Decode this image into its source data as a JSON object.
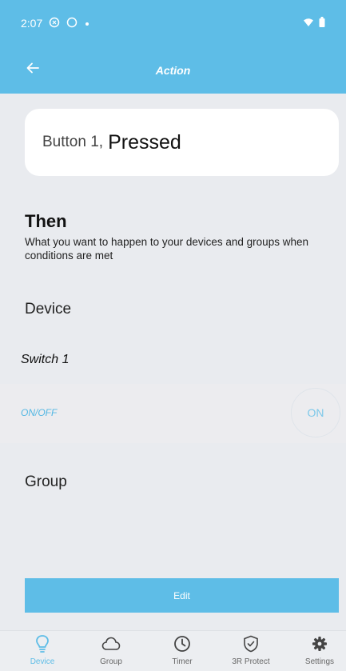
{
  "status_bar": {
    "time": "2:07"
  },
  "app_bar": {
    "title": "Action"
  },
  "trigger": {
    "source": "Button 1,",
    "state": "Pressed"
  },
  "then": {
    "title": "Then",
    "description": "What you want to happen to your devices and groups when conditions are met"
  },
  "device_section": {
    "label": "Device",
    "switch_name": "Switch 1",
    "control_label": "ON/OFF",
    "control_value": "ON"
  },
  "group_section": {
    "label": "Group"
  },
  "edit_button": {
    "label": "Edit"
  },
  "bottom_nav": {
    "active": "Device",
    "items": [
      {
        "label": "Device",
        "icon": "lightbulb-icon"
      },
      {
        "label": "Group",
        "icon": "cloud-icon"
      },
      {
        "label": "Timer",
        "icon": "clock-icon"
      },
      {
        "label": "3R Protect",
        "icon": "shield-check-icon"
      },
      {
        "label": "Settings",
        "icon": "gear-icon"
      }
    ]
  },
  "colors": {
    "accent": "#5ebde7",
    "background": "#e9ebef",
    "card": "#ffffff"
  }
}
